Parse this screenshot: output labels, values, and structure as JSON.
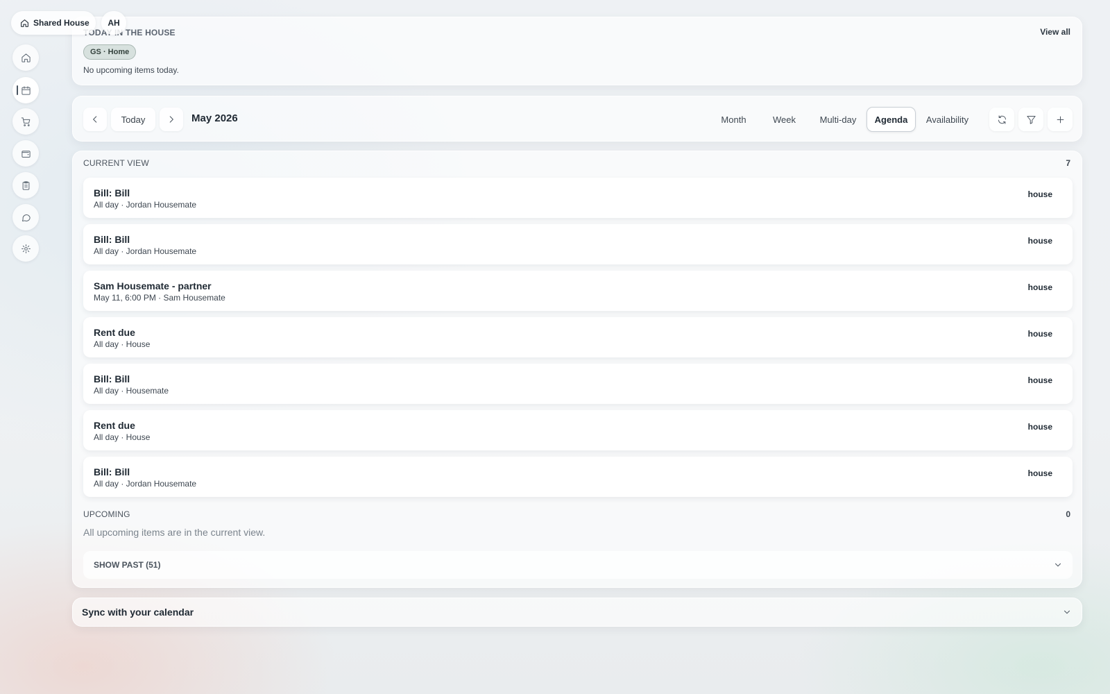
{
  "header": {
    "house_name": "Shared House",
    "avatar_initials": "AH"
  },
  "sidebar": {
    "items": [
      {
        "icon": "home-icon",
        "label": "Home"
      },
      {
        "icon": "calendar-icon",
        "label": "Calendar",
        "active": true
      },
      {
        "icon": "cart-icon",
        "label": "Shopping"
      },
      {
        "icon": "wallet-icon",
        "label": "Finances"
      },
      {
        "icon": "clipboard-icon",
        "label": "Chores"
      },
      {
        "icon": "chat-icon",
        "label": "Chat"
      },
      {
        "icon": "gear-icon",
        "label": "Settings"
      }
    ]
  },
  "today": {
    "title": "TODAY IN THE HOUSE",
    "view_all": "View all",
    "chip": "GS · Home",
    "empty_text": "No upcoming items today."
  },
  "calendar_nav": {
    "today_label": "Today",
    "month_label": "May 2026",
    "views": [
      "Month",
      "Week",
      "Multi-day",
      "Agenda",
      "Availability"
    ],
    "active_view": "Agenda"
  },
  "current_view": {
    "title": "CURRENT VIEW",
    "count": "7",
    "events": [
      {
        "title": "Bill: Bill",
        "subtitle": "All day · Jordan Housemate",
        "tag": "house"
      },
      {
        "title": "Bill: Bill",
        "subtitle": "All day · Jordan Housemate",
        "tag": "house"
      },
      {
        "title": "Sam Housemate - partner",
        "subtitle": "May 11, 6:00 PM · Sam Housemate",
        "tag": "house"
      },
      {
        "title": "Rent due",
        "subtitle": "All day · House",
        "tag": "house"
      },
      {
        "title": "Bill: Bill",
        "subtitle": "All day · Housemate",
        "tag": "house"
      },
      {
        "title": "Rent due",
        "subtitle": "All day · House",
        "tag": "house"
      },
      {
        "title": "Bill: Bill",
        "subtitle": "All day · Jordan Housemate",
        "tag": "house"
      }
    ]
  },
  "upcoming": {
    "title": "UPCOMING",
    "count": "0",
    "empty_text": "All upcoming items are in the current view.",
    "show_past_label": "SHOW PAST (51)"
  },
  "sync": {
    "title": "Sync with your calendar"
  }
}
